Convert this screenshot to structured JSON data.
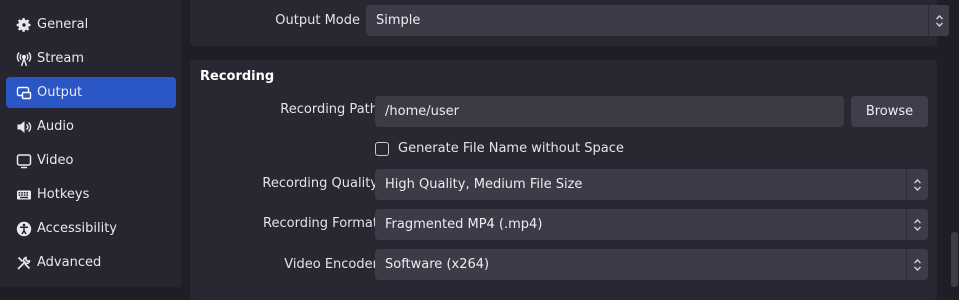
{
  "sidebar": {
    "items": [
      {
        "label": "General",
        "icon": "gear-icon",
        "active": false
      },
      {
        "label": "Stream",
        "icon": "broadcast-icon",
        "active": false
      },
      {
        "label": "Output",
        "icon": "output-icon",
        "active": true
      },
      {
        "label": "Audio",
        "icon": "speaker-icon",
        "active": false
      },
      {
        "label": "Video",
        "icon": "monitor-icon",
        "active": false
      },
      {
        "label": "Hotkeys",
        "icon": "keyboard-icon",
        "active": false
      },
      {
        "label": "Accessibility",
        "icon": "accessibility-icon",
        "active": false
      },
      {
        "label": "Advanced",
        "icon": "tools-icon",
        "active": false
      }
    ]
  },
  "output_mode": {
    "label": "Output Mode",
    "value": "Simple"
  },
  "recording": {
    "title": "Recording",
    "path_label": "Recording Path",
    "path_value": "/home/user",
    "browse_label": "Browse",
    "generate_filename_label": "Generate File Name without Space",
    "generate_filename_checked": false,
    "quality_label": "Recording Quality",
    "quality_value": "High Quality, Medium File Size",
    "format_label": "Recording Format",
    "format_value": "Fragmented MP4 (.mp4)",
    "encoder_label": "Video Encoder",
    "encoder_value": "Software (x264)"
  },
  "colors": {
    "accent": "#2a56c6",
    "panel": "#272831",
    "background": "#1e1f26"
  }
}
